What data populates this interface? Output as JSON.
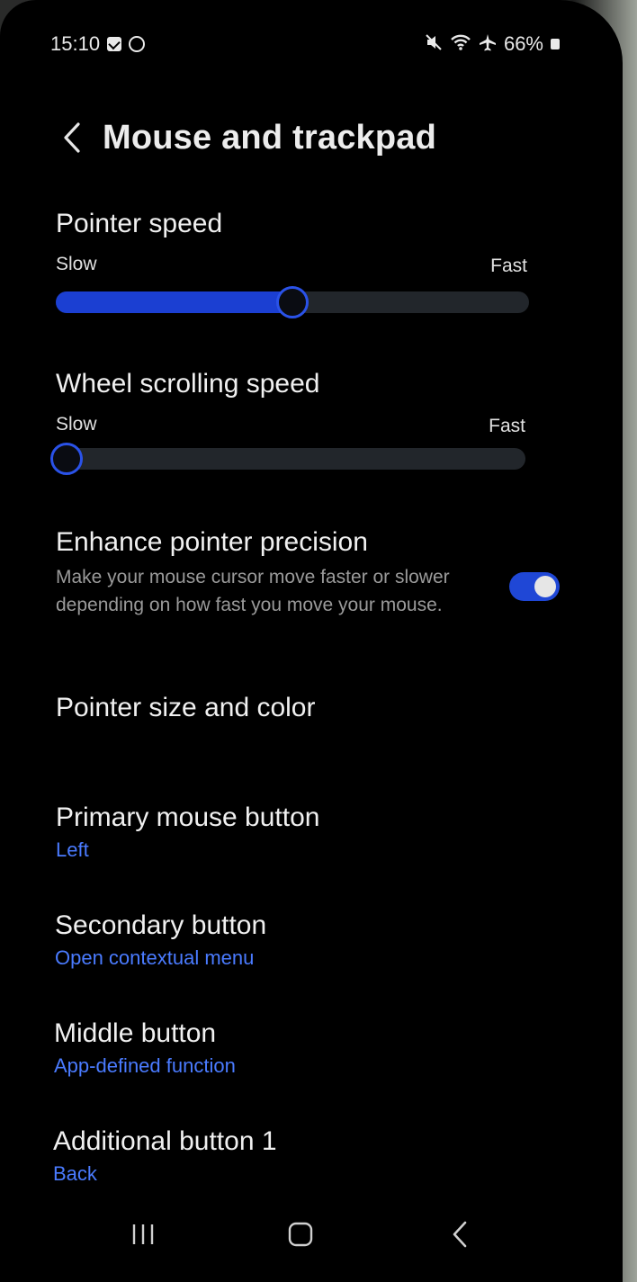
{
  "status": {
    "time": "15:10",
    "battery_percent": "66%",
    "icons": [
      "checkbox-notification-icon",
      "ring-notification-icon",
      "mute-icon",
      "wifi-icon",
      "airplane-icon",
      "battery-icon"
    ]
  },
  "header": {
    "title": "Mouse and trackpad",
    "back_icon": "chevron-left-icon"
  },
  "pointer_speed": {
    "title": "Pointer speed",
    "min_label": "Slow",
    "max_label": "Fast",
    "value": 0.5
  },
  "wheel_speed": {
    "title": "Wheel scrolling speed",
    "min_label": "Slow",
    "max_label": "Fast",
    "value": 0.0
  },
  "enhance_precision": {
    "title": "Enhance pointer precision",
    "description": "Make your mouse cursor move faster or slower depending on how fast you move your mouse.",
    "enabled": true
  },
  "pointer_size": {
    "title": "Pointer size and color"
  },
  "primary_button": {
    "title": "Primary mouse button",
    "value": "Left"
  },
  "secondary_button": {
    "title": "Secondary button",
    "value": "Open contextual menu"
  },
  "middle_button": {
    "title": "Middle button",
    "value": "App-defined function"
  },
  "additional_button_1": {
    "title": "Additional button 1",
    "value": "Back"
  },
  "nav": {
    "recents_icon": "recents-icon",
    "home_icon": "home-icon",
    "back_icon": "back-icon"
  },
  "colors": {
    "accent": "#2a52e8",
    "value_text": "#4a7bff",
    "background": "#000000"
  }
}
